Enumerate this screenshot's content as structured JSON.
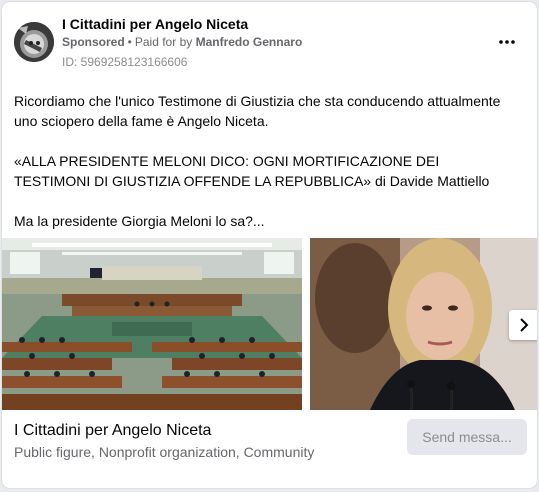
{
  "post": {
    "page_name": "I Cittadini per Angelo Niceta",
    "sponsored_label": "Sponsored",
    "separator": "•",
    "paid_for_prefix": "Paid for by",
    "payer": "Manfredo Gennaro",
    "ad_id": "ID: 5969258123166606",
    "more_icon": "more-horizontal-icon",
    "paragraphs": [
      "Ricordiamo che l'unico Testimone di Giustizia che sta conducendo attualmente uno sciopero della fame è Angelo Niceta.",
      "«ALLA PRESIDENTE MELONI DICO: OGNI MORTIFICAZIONE DEI TESTIMONI DI GIUSTIZIA OFFENDE LA REPUBBLICA» di Davide Mattiello",
      "Ma la presidente Giorgia Meloni lo sa?..."
    ]
  },
  "carousel": {
    "next_icon": "chevron-right-icon"
  },
  "footer": {
    "title": "I Cittadini per Angelo Niceta",
    "subtitle": "Public figure, Nonprofit organization, Community",
    "send_button": "Send messa..."
  },
  "colors": {
    "primary_text": "#050505",
    "secondary_text": "#65676b",
    "button_bg": "#e4e6eb"
  }
}
